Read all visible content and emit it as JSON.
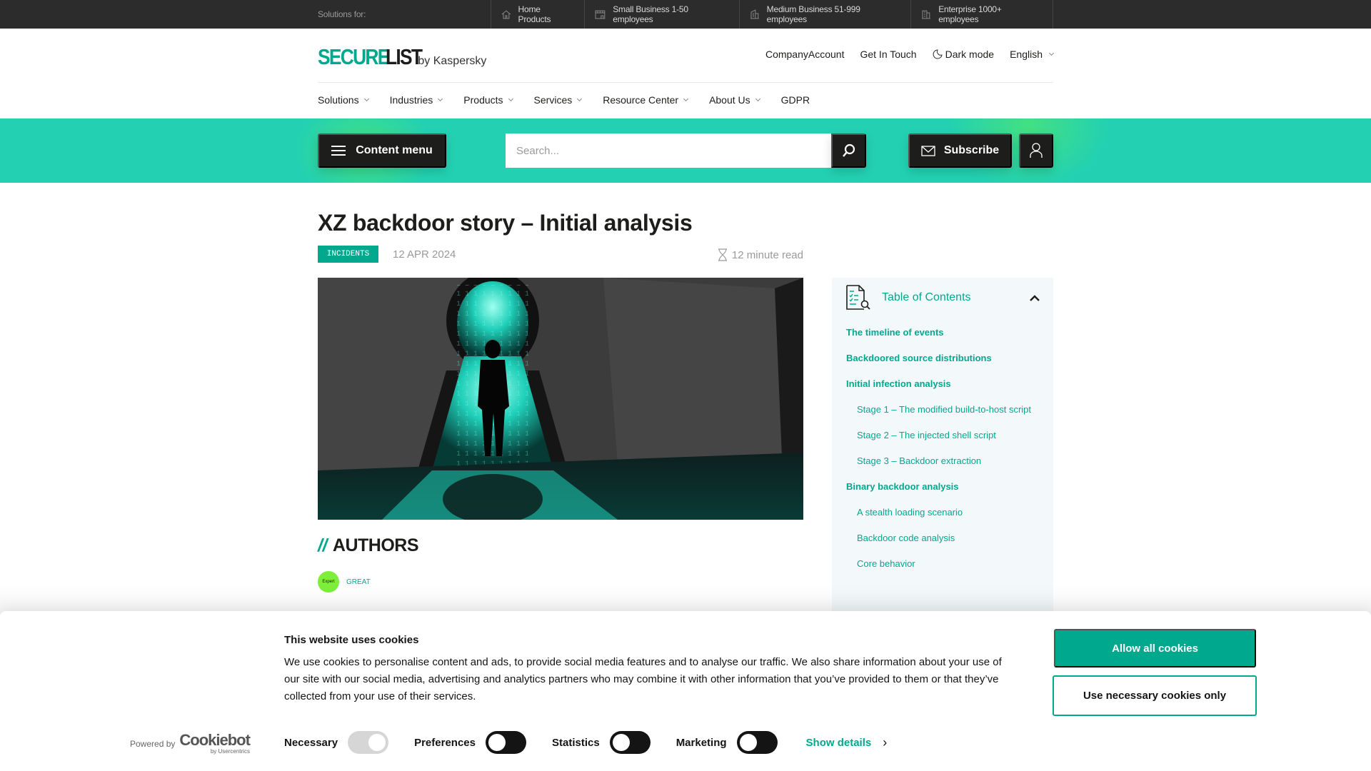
{
  "topbar": {
    "solutions_for": "Solutions for:",
    "items": [
      {
        "label": "Home Products",
        "icon": "house-icon"
      },
      {
        "label": "Small Business 1-50 employees",
        "icon": "shop-icon"
      },
      {
        "label": "Medium Business 51-999 employees",
        "icon": "office-building-icon"
      },
      {
        "label": "Enterprise 1000+ employees",
        "icon": "skyscraper-icon"
      }
    ]
  },
  "header": {
    "logo_secure": "SECURE",
    "logo_list": "LIST",
    "logo_by": "by Kaspersky",
    "util": {
      "company_account": "CompanyAccount",
      "get_in_touch": "Get In Touch",
      "dark_mode": "Dark mode",
      "language": "English"
    },
    "nav": [
      {
        "label": "Solutions",
        "has_dropdown": true
      },
      {
        "label": "Industries",
        "has_dropdown": true
      },
      {
        "label": "Products",
        "has_dropdown": true
      },
      {
        "label": "Services",
        "has_dropdown": true
      },
      {
        "label": "Resource Center",
        "has_dropdown": true
      },
      {
        "label": "About Us",
        "has_dropdown": true
      },
      {
        "label": "GDPR",
        "has_dropdown": false
      }
    ]
  },
  "band": {
    "content_menu": "Content menu",
    "search_placeholder": "Search...",
    "search_value": "",
    "subscribe": "Subscribe"
  },
  "article": {
    "title": "XZ backdoor story – Initial analysis",
    "tag": "INCIDENTS",
    "date": "12 APR 2024",
    "read_time": "12 minute read",
    "authors_slashes": "//",
    "authors_heading": "AUTHORS",
    "authors": [
      {
        "avatar_text": "Expert",
        "name": "GREAT"
      }
    ]
  },
  "toc": {
    "title": "Table of Contents",
    "items": [
      {
        "label": "The timeline of events",
        "level": 1
      },
      {
        "label": "Backdoored source distributions",
        "level": 1
      },
      {
        "label": "Initial infection analysis",
        "level": 1
      },
      {
        "label": "Stage 1 – The modified build-to-host script",
        "level": 2
      },
      {
        "label": "Stage 2 – The injected shell script",
        "level": 2
      },
      {
        "label": "Stage 3 – Backdoor extraction",
        "level": 2
      },
      {
        "label": "Binary backdoor analysis",
        "level": 1
      },
      {
        "label": "A stealth loading scenario",
        "level": 2
      },
      {
        "label": "Backdoor code analysis",
        "level": 2
      },
      {
        "label": "Core behavior",
        "level": 2
      }
    ]
  },
  "cookie": {
    "title": "This website uses cookies",
    "text": "We use cookies to personalise content and ads, to provide social media features and to analyse our traffic. We also share information about your use of our site with our social media, advertising and analytics partners who may combine it with other information that you’ve provided to them or that they’ve collected from your use of their services.",
    "allow_all": "Allow all cookies",
    "necessary_only": "Use necessary cookies only",
    "powered_by": "Powered by",
    "cookiebot": "Cookiebot",
    "cookiebot_sub": "by Usercentrics",
    "toggles": [
      {
        "label": "Necessary",
        "state": "on-disabled"
      },
      {
        "label": "Preferences",
        "state": "off"
      },
      {
        "label": "Statistics",
        "state": "off"
      },
      {
        "label": "Marketing",
        "state": "off"
      }
    ],
    "show_details": "Show details"
  },
  "colors": {
    "brand_teal": "#00a88e",
    "band_teal": "#23d1b2",
    "dark": "#1d1d1b",
    "topbar": "#2c2c2c",
    "toc_bg": "#f3f9fb"
  }
}
